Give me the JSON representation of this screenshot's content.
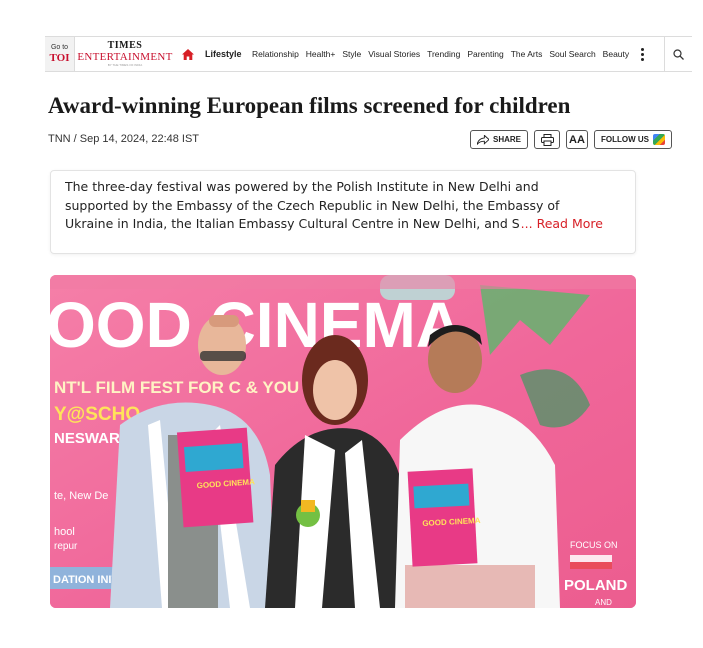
{
  "nav": {
    "goto_small": "Go to",
    "goto_brand": "TOI",
    "brand_top": "TIMES",
    "brand_bottom": "ENTERTAINMENT",
    "brand_tagline": "BY THE TIMES OF INDIA",
    "home_icon": "home-icon",
    "items": [
      {
        "label": "Lifestyle",
        "active": true
      },
      {
        "label": "Relationship"
      },
      {
        "label": "Health+"
      },
      {
        "label": "Style"
      },
      {
        "label": "Visual Stories"
      },
      {
        "label": "Trending"
      },
      {
        "label": "Parenting"
      },
      {
        "label": "The Arts"
      },
      {
        "label": "Soul Search"
      },
      {
        "label": "Beauty"
      }
    ],
    "more_icon": "more-vertical-icon",
    "search_icon": "search-icon"
  },
  "article": {
    "title": "Award-winning European films screened for children",
    "byline": "TNN / Sep 14, 2024, 22:48 IST",
    "actions": {
      "share": "SHARE",
      "print_icon": "print-icon",
      "font_size": "AA",
      "follow": "FOLLOW US"
    },
    "summary_lines": [
      "The three-day festival was powered by the Polish Institute in New Delhi and",
      "supported by the Embassy of the Czech Republic in New Delhi, the Embassy of",
      "Ukraine in India, the Italian Embassy Cultural Centre in New Delhi, and S"
    ],
    "read_more": "... Read More"
  },
  "image": {
    "banner_big": "OOD CINEMA",
    "banner_line": "NT'L FILM FEST   FOR C      & YOU",
    "banner_left1": "Y@SCHO",
    "banner_left2": "NESWAR, S",
    "banner_left3": "te, New De",
    "banner_left4": "hool",
    "banner_left5": "repur",
    "banner_left6": "DATION INITIATIV",
    "focus_on": "FOCUS ON",
    "poland": "POLAND",
    "and": "AND",
    "magazine_title": "GOOD CINEMA",
    "colors": {
      "background": "#f26a9a",
      "accent": "#d71f26"
    }
  }
}
